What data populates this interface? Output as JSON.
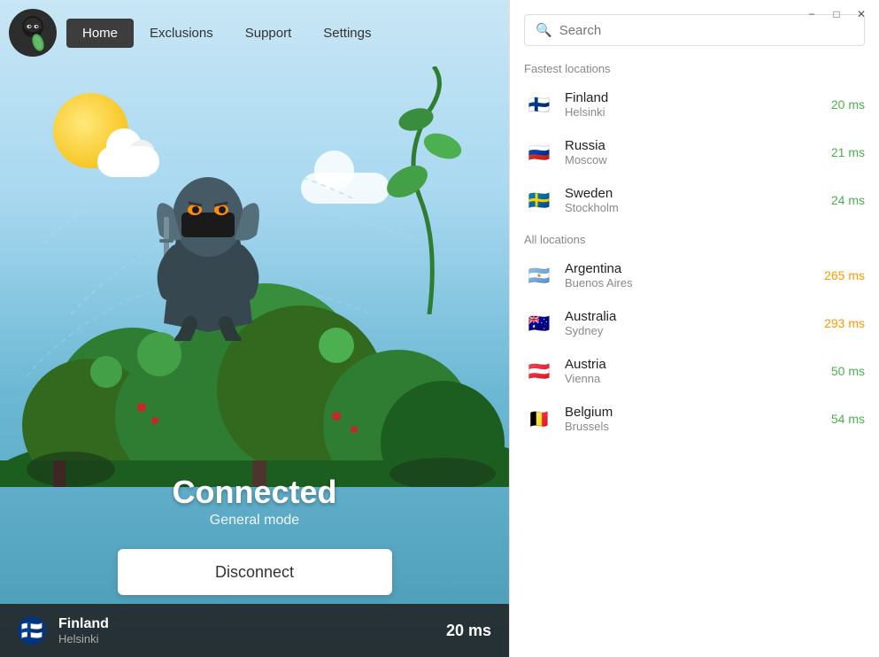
{
  "titlebar": {
    "minimize_label": "−",
    "maximize_label": "□",
    "close_label": "✕"
  },
  "nav": {
    "home_label": "Home",
    "exclusions_label": "Exclusions",
    "support_label": "Support",
    "settings_label": "Settings"
  },
  "main": {
    "connected_label": "Connected",
    "mode_label": "General mode",
    "disconnect_label": "Disconnect"
  },
  "status_bar": {
    "country": "Finland",
    "city": "Helsinki",
    "latency": "20 ms"
  },
  "search": {
    "placeholder": "Search"
  },
  "fastest_locations": {
    "section_label": "Fastest locations",
    "items": [
      {
        "country": "Finland",
        "city": "Helsinki",
        "latency": "20 ms",
        "latency_class": "fast",
        "flag": "🇫🇮"
      },
      {
        "country": "Russia",
        "city": "Moscow",
        "latency": "21 ms",
        "latency_class": "fast",
        "flag": "🇷🇺"
      },
      {
        "country": "Sweden",
        "city": "Stockholm",
        "latency": "24 ms",
        "latency_class": "fast",
        "flag": "🇸🇪"
      }
    ]
  },
  "all_locations": {
    "section_label": "All locations",
    "items": [
      {
        "country": "Argentina",
        "city": "Buenos Aires",
        "latency": "265 ms",
        "latency_class": "medium",
        "flag": "🇦🇷"
      },
      {
        "country": "Australia",
        "city": "Sydney",
        "latency": "293 ms",
        "latency_class": "medium",
        "flag": "🇦🇺"
      },
      {
        "country": "Austria",
        "city": "Vienna",
        "latency": "50 ms",
        "latency_class": "fast",
        "flag": "🇦🇹"
      },
      {
        "country": "Belgium",
        "city": "Brussels",
        "latency": "54 ms",
        "latency_class": "fast",
        "flag": "🇧🇪"
      }
    ]
  }
}
